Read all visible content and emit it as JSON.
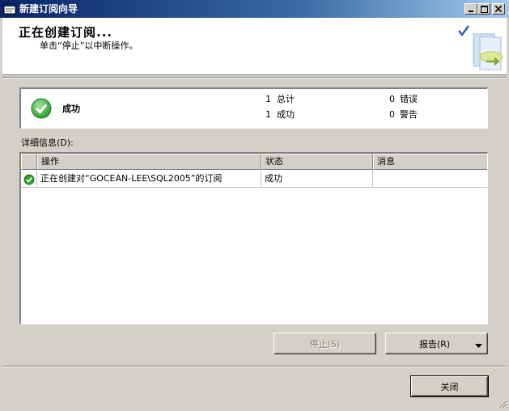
{
  "window": {
    "title": "新建订阅向导"
  },
  "header": {
    "title": "正在创建订阅...",
    "subtitle": "单击“停止”以中断操作。"
  },
  "summary": {
    "status": "成功",
    "total_count": "1",
    "total_label": "总计",
    "success_count": "1",
    "success_label": "成功",
    "error_count": "0",
    "error_label": "错误",
    "warning_count": "0",
    "warning_label": "警告"
  },
  "details": {
    "label": "详细信息(D):",
    "columns": [
      "操作",
      "状态",
      "消息"
    ],
    "rows": [
      {
        "action": "正在创建对“GOCEAN-LEE\\SQL2005”的订阅",
        "status": "成功",
        "message": ""
      }
    ]
  },
  "buttons": {
    "stop": "停止(S)",
    "report": "报告(R)",
    "close": "关闭"
  },
  "colors": {
    "success_green": "#2e9e2e",
    "title_bar": "#0a246a"
  }
}
